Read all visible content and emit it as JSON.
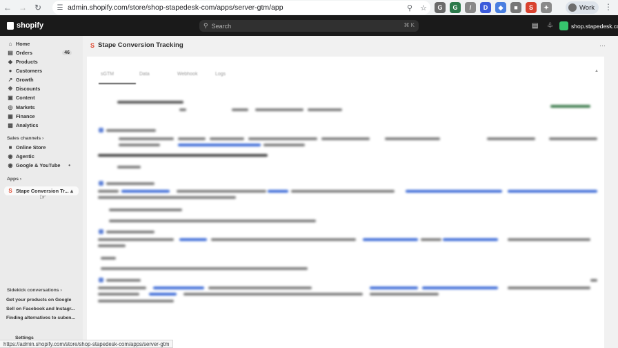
{
  "browser": {
    "url": "admin.shopify.com/store/shop-stapedesk-com/apps/server-gtm/app",
    "profile_label": "Work",
    "status_url": "https://admin.shopify.com/store/shop-stapedesk-com/apps/server-gtm"
  },
  "topbar": {
    "brand": "shopify",
    "search_placeholder": "Search",
    "search_shortcut": "⌘ K",
    "store_name": "shop.stapedesk.com"
  },
  "sidebar": {
    "items": [
      {
        "label": "Home",
        "icon": "home-icon"
      },
      {
        "label": "Orders",
        "icon": "orders-icon",
        "badge": "46"
      },
      {
        "label": "Products",
        "icon": "tag-icon"
      },
      {
        "label": "Customers",
        "icon": "person-icon"
      },
      {
        "label": "Growth",
        "icon": "growth-icon"
      },
      {
        "label": "Discounts",
        "icon": "discount-icon"
      },
      {
        "label": "Content",
        "icon": "content-icon"
      },
      {
        "label": "Markets",
        "icon": "globe-icon"
      },
      {
        "label": "Finance",
        "icon": "bank-icon"
      },
      {
        "label": "Analytics",
        "icon": "chart-icon"
      }
    ],
    "sales_channels_label": "Sales channels",
    "channels": [
      {
        "label": "Online Store"
      },
      {
        "label": "Agentic"
      },
      {
        "label": "Google & YouTube"
      }
    ],
    "apps_label": "Apps",
    "apps": [
      {
        "label": "Stape Conversion Tr..."
      }
    ],
    "sidekick_label": "Sidekick conversations",
    "sidekick_items": [
      {
        "label": "Get your products on Google"
      },
      {
        "label": "Sell on Facebook and Instagr..."
      },
      {
        "label": "Finding alternatives to suben..."
      }
    ],
    "settings_label": "Settings"
  },
  "main": {
    "title": "Stape Conversion Tracking",
    "tabs": [
      "sGTM",
      "Data",
      "Webhook",
      "Logs"
    ]
  },
  "colors": {
    "topbar": "#1a1a1a",
    "sidebar": "#ebebeb",
    "accent": "#e0462d",
    "store_avatar": "#36c46d",
    "link_blur": "#3c6ad6"
  }
}
